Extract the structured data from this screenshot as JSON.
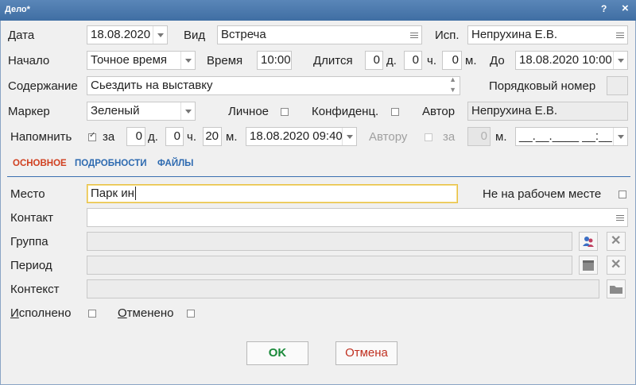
{
  "window": {
    "title": "Дело*",
    "help": "?",
    "close": "×"
  },
  "row1": {
    "date_label": "Дата",
    "date_value": "18.08.2020",
    "type_label": "Вид",
    "type_value": "Встреча",
    "exec_label": "Исп.",
    "exec_value": "Непрухина Е.В."
  },
  "row2": {
    "start_label": "Начало",
    "start_value": "Точное время",
    "time_label": "Время",
    "time_value": "10:00",
    "dur_label": "Длится",
    "dur_days": "0",
    "dur_days_unit": "д.",
    "dur_hours": "0",
    "dur_hours_unit": "ч.",
    "dur_min": "0",
    "dur_min_unit": "м.",
    "until_label": "До",
    "until_value": "18.08.2020 10:00"
  },
  "row3": {
    "content_label": "Содержание",
    "content_value": "Сьездить на выставку",
    "order_label": "Порядковый номер",
    "order_value": ""
  },
  "row4": {
    "marker_label": "Маркер",
    "marker_value": "Зеленый",
    "personal_label": "Личное",
    "confidential_label": "Конфиденц.",
    "author_label": "Автор",
    "author_value": "Непрухина Е.В."
  },
  "row5": {
    "remind_label": "Напомнить",
    "for_label": "за",
    "rem_days": "0",
    "rem_days_unit": "д.",
    "rem_hours": "0",
    "rem_hours_unit": "ч.",
    "rem_min": "20",
    "rem_min_unit": "м.",
    "rem_datetime": "18.08.2020 09:40",
    "author_label": "Автору",
    "a_for_label": "за",
    "a_min": "0",
    "a_min_unit": "м.",
    "a_datetime": "__.__.____ __:__"
  },
  "tabs": [
    {
      "label": "ОСНОВНОЕ"
    },
    {
      "label": "ПОДРОБНОСТИ"
    },
    {
      "label": "ФАЙЛЫ"
    }
  ],
  "main": {
    "place_label": "Место",
    "place_value": "Парк ин",
    "offsite_label": "Не на рабочем месте",
    "contact_label": "Контакт",
    "contact_value": "",
    "group_label": "Группа",
    "group_value": "",
    "period_label": "Период",
    "period_value": "",
    "context_label": "Контекст",
    "context_value": "",
    "done_label": "Исполнено",
    "cancelled_label": "Отменено"
  },
  "buttons": {
    "ok": "OK",
    "cancel": "Отмена"
  },
  "colors": {
    "titlebar": "#3f6ea3",
    "active_tab": "#d04020",
    "tab": "#2d6ab0",
    "ok_text": "#1a8a3a",
    "cancel_text": "#c03020",
    "focus_border": "#e8c040"
  }
}
